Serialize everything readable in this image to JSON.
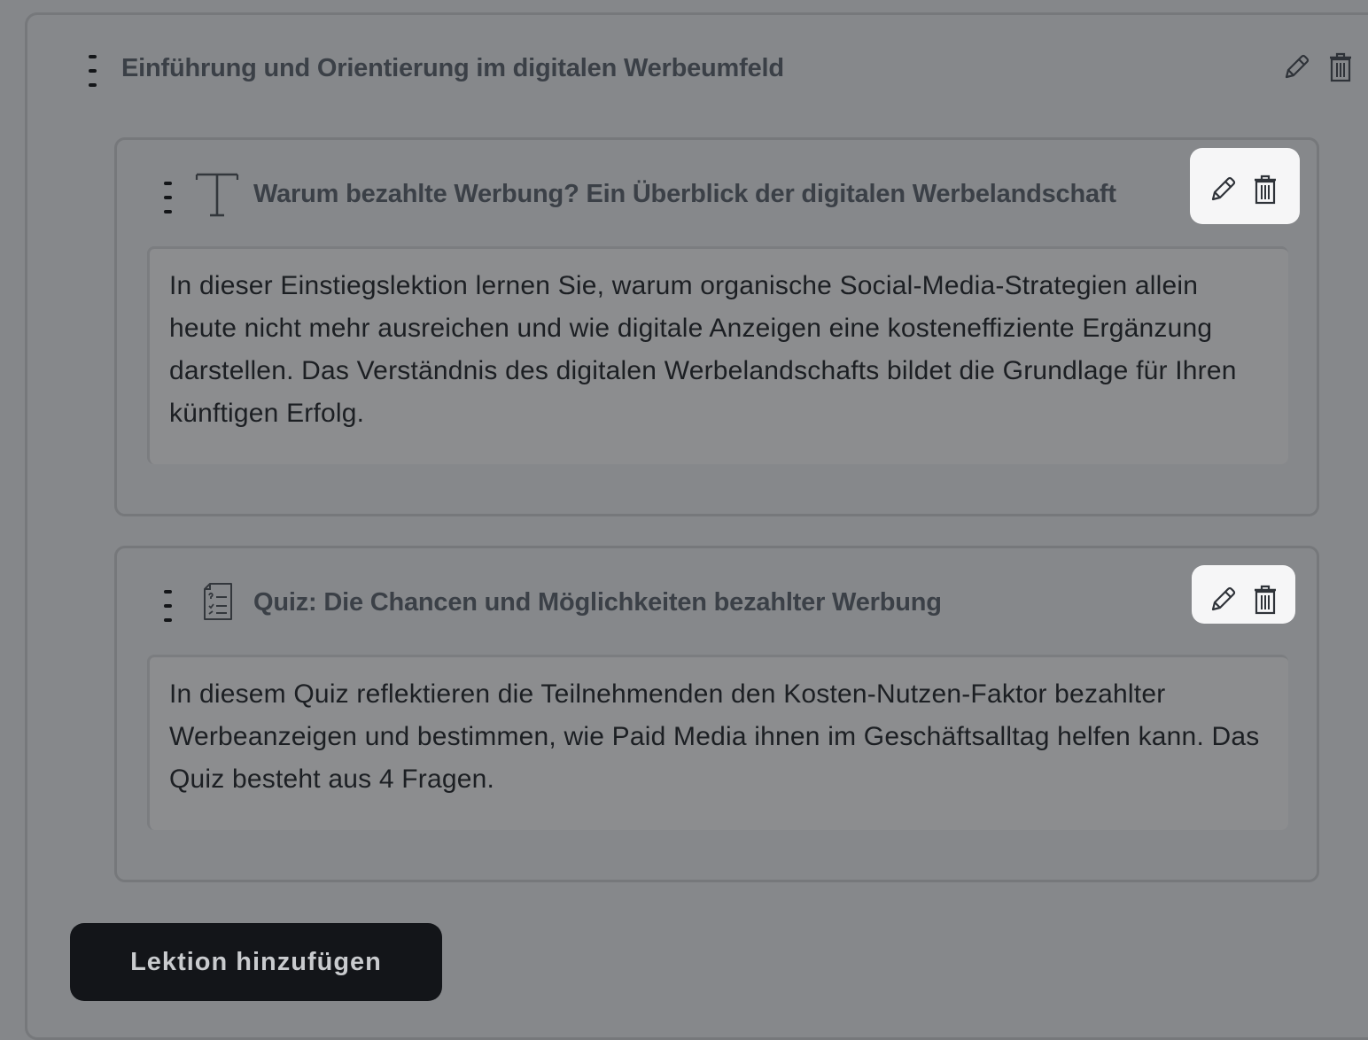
{
  "module": {
    "title": "Einführung und Orientierung im digitalen Werbeumfeld",
    "edit_icon": "pencil-icon",
    "delete_icon": "trash-icon",
    "drag_icon": "drag-handle-icon"
  },
  "lessons": [
    {
      "type_icon": "text-type-icon",
      "title": "Warum bezahlte Werbung? Ein Überblick der digitalen Werbelandschaft",
      "description": "In dieser Einstiegslektion lernen Sie, warum organische Social-Media-Strategien allein heute nicht mehr ausreichen und wie digitale Anzeigen eine kosteneffiziente Ergänzung darstellen. Das Verständnis des digitalen Werbelandschafts bildet die Grundlage für Ihren künftigen Erfolg.",
      "edit_icon": "pencil-icon",
      "delete_icon": "trash-icon"
    },
    {
      "type_icon": "quiz-document-icon",
      "title": "Quiz: Die Chancen und Möglichkeiten bezahlter Werbung",
      "description": "In diesem Quiz reflektieren die Teilnehmenden den Kosten-Nutzen-Faktor bezahlter Werbeanzeigen und bestimmen, wie Paid Media ihnen im Geschäftsalltag helfen kann. Das Quiz besteht aus 4 Fragen.",
      "edit_icon": "pencil-icon",
      "delete_icon": "trash-icon"
    }
  ],
  "add_lesson_button": {
    "label": "Lektion hinzufügen"
  },
  "colors": {
    "overlay_background": "#85878a",
    "button_dark": "#131519",
    "action_box": "#f6f6f7",
    "text_dark": "#3b4047"
  }
}
